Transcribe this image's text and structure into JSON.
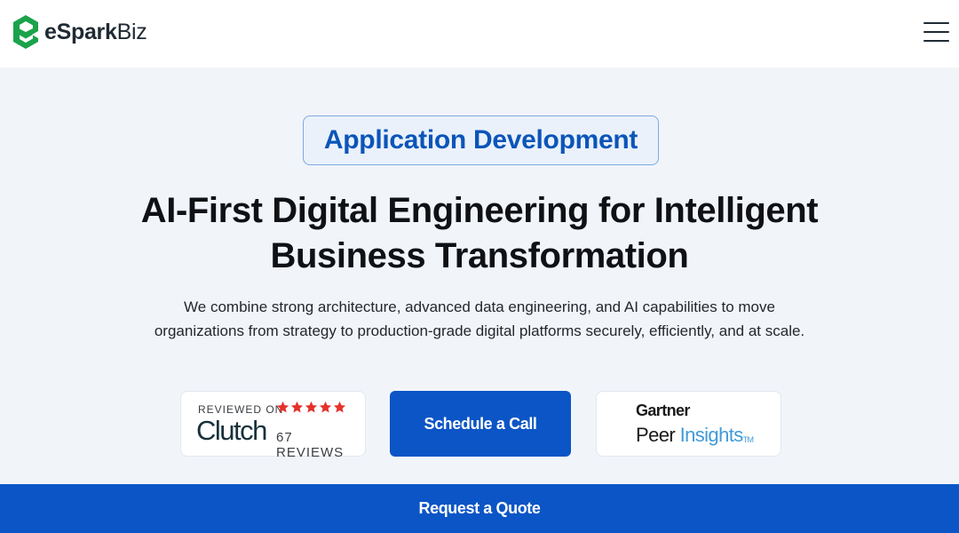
{
  "header": {
    "logo": {
      "text_bold": "eSpark",
      "text_light": "Biz",
      "brand_color": "#1aa34a"
    },
    "menu_icon": "hamburger-icon"
  },
  "hero": {
    "badge": "Application Development",
    "title_lines": [
      "AI-First Digital Engineering for Intelligent",
      "Business Transformation"
    ],
    "description_lines": [
      "We combine strong architecture, advanced data engineering, and AI capabilities to move",
      "organizations from strategy to production-grade digital platforms securely, efficiently, and at scale."
    ]
  },
  "clutch": {
    "reviewed_on": "REVIEWED ON",
    "name": "Clutch",
    "rating_stars": 5,
    "reviews": "67 REVIEWS",
    "star_color": "#e4322b"
  },
  "cta": {
    "label": "Schedule a Call",
    "color": "#0b55c6"
  },
  "gartner": {
    "name": "Gartner",
    "peer": "Peer",
    "insights": "Insights",
    "tm": "TM"
  },
  "quote_bar": {
    "label": "Request a Quote"
  }
}
